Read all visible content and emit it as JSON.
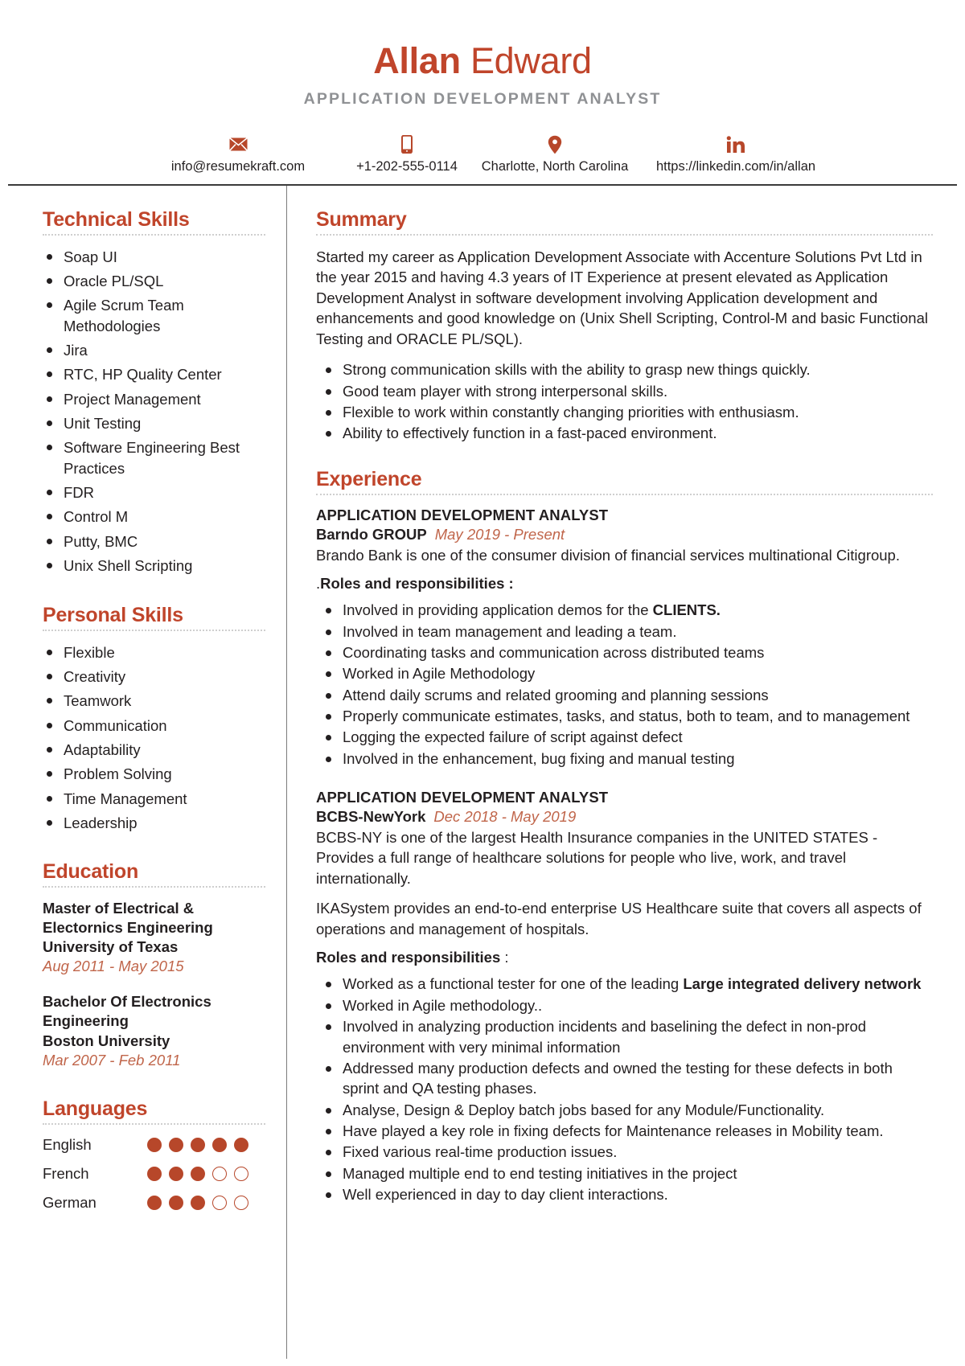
{
  "header": {
    "first_name": "Allan",
    "last_name": "Edward",
    "job_title": "APPLICATION DEVELOPMENT ANALYST",
    "contacts": [
      {
        "icon": "envelope-icon",
        "text": "info@resumekraft.com"
      },
      {
        "icon": "mobile-phone-icon",
        "text": "+1-202-555-0114"
      },
      {
        "icon": "map-pin-icon",
        "text": "Charlotte, North Carolina"
      },
      {
        "icon": "linkedin-icon",
        "text": "https://linkedin.com/in/allan"
      }
    ]
  },
  "sidebar": {
    "technical_skills": {
      "heading": "Technical Skills",
      "items": [
        "Soap UI",
        "Oracle PL/SQL",
        "Agile Scrum Team Methodologies",
        "Jira",
        "RTC, HP Quality Center",
        "Project Management",
        "Unit Testing",
        "Software Engineering Best Practices",
        "FDR",
        "Control M",
        "Putty, BMC",
        "Unix Shell Scripting"
      ]
    },
    "personal_skills": {
      "heading": "Personal Skills",
      "items": [
        "Flexible",
        "Creativity",
        "Teamwork",
        "Communication",
        "Adaptability",
        "Problem Solving",
        "Time Management",
        "Leadership"
      ]
    },
    "education": {
      "heading": "Education",
      "items": [
        {
          "degree": "Master of Electrical & Electornics Engineering",
          "school": "University of Texas",
          "dates": "Aug 2011 - May 2015"
        },
        {
          "degree": "Bachelor Of Electronics Engineering",
          "school": "Boston University",
          "dates": "Mar 2007 - Feb 2011"
        }
      ]
    },
    "languages": {
      "heading": "Languages",
      "max_level": 5,
      "items": [
        {
          "name": "English",
          "level": 5
        },
        {
          "name": "French",
          "level": 3
        },
        {
          "name": "German",
          "level": 3
        }
      ]
    }
  },
  "main": {
    "summary": {
      "heading": "Summary",
      "paragraph": "Started my career as Application Development Associate with Accenture Solutions Pvt Ltd in the year 2015 and having 4.3 years of IT Experience at present elevated as Application Development Analyst in software development involving Application development and enhancements and good knowledge on (Unix Shell Scripting, Control-M and basic Functional Testing and ORACLE PL/SQL).",
      "bullets": [
        "Strong communication skills with the ability to grasp new things quickly.",
        "Good team player with strong interpersonal skills.",
        "Flexible to work within constantly changing priorities with enthusiasm.",
        "Ability to effectively function in a fast-paced environment."
      ]
    },
    "experience": {
      "heading": "Experience",
      "jobs": [
        {
          "role": "APPLICATION DEVELOPMENT ANALYST",
          "company": "Barndo GROUP",
          "dates": "May 2019 - Present",
          "description": "Brando Bank is one of the consumer division of financial services multinational Citigroup.",
          "description2": "",
          "rr_prefix": ".",
          "rr_label": "Roles and responsibilities :",
          "rr_suffix": "",
          "bullets": [
            {
              "text": "Involved in providing application demos for the ",
              "bold_tail": "CLIENTS."
            },
            {
              "text": "Involved in team management and leading a team.",
              "bold_tail": ""
            },
            {
              "text": "Coordinating tasks and communication across distributed teams",
              "bold_tail": ""
            },
            {
              "text": "Worked in Agile Methodology",
              "bold_tail": ""
            },
            {
              "text": "Attend daily scrums and related grooming and planning sessions",
              "bold_tail": ""
            },
            {
              "text": "Properly communicate estimates, tasks, and status, both to team, and to management",
              "bold_tail": ""
            },
            {
              "text": "Logging the expected failure of script against defect",
              "bold_tail": ""
            },
            {
              "text": "Involved in the enhancement, bug fixing and manual testing",
              "bold_tail": ""
            }
          ]
        },
        {
          "role": "APPLICATION DEVELOPMENT ANALYST",
          "company": "BCBS-NewYork",
          "dates": "Dec 2018 - May 2019",
          "description": "BCBS-NY is one of the largest Health Insurance companies in the UNITED STATES - Provides a full range of healthcare solutions for people who live, work, and travel internationally.",
          "description2": "IKASystem provides an end-to-end enterprise US Healthcare suite that covers all aspects of operations and management of hospitals.",
          "rr_prefix": "",
          "rr_label": "Roles and responsibilities",
          "rr_suffix": " :",
          "bullets": [
            {
              "text": "Worked as a functional tester for one of the leading ",
              "bold_tail": "Large integrated delivery network"
            },
            {
              "text": "Worked in Agile methodology..",
              "bold_tail": ""
            },
            {
              "text": "Involved in analyzing production incidents and baselining the defect in non-prod environment with very minimal information",
              "bold_tail": ""
            },
            {
              "text": "Addressed many production defects and owned the testing for these defects in both sprint and QA testing phases.",
              "bold_tail": ""
            },
            {
              "text": "Analyse, Design & Deploy batch jobs based for any Module/Functionality.",
              "bold_tail": ""
            },
            {
              "text": "Have played a key role in fixing defects for Maintenance releases in Mobility team.",
              "bold_tail": ""
            },
            {
              "text": "Fixed various real-time production issues.",
              "bold_tail": ""
            },
            {
              "text": "Managed multiple end to end testing initiatives in the project",
              "bold_tail": ""
            },
            {
              "text": "Well experienced in day to day client interactions.",
              "bold_tail": ""
            }
          ]
        }
      ]
    }
  },
  "colors": {
    "accent": "#c0452b",
    "accent_icon": "#b7472a",
    "subtitle_gray": "#8f9194",
    "date_text": "#c0654a",
    "body_text": "#231f20"
  }
}
